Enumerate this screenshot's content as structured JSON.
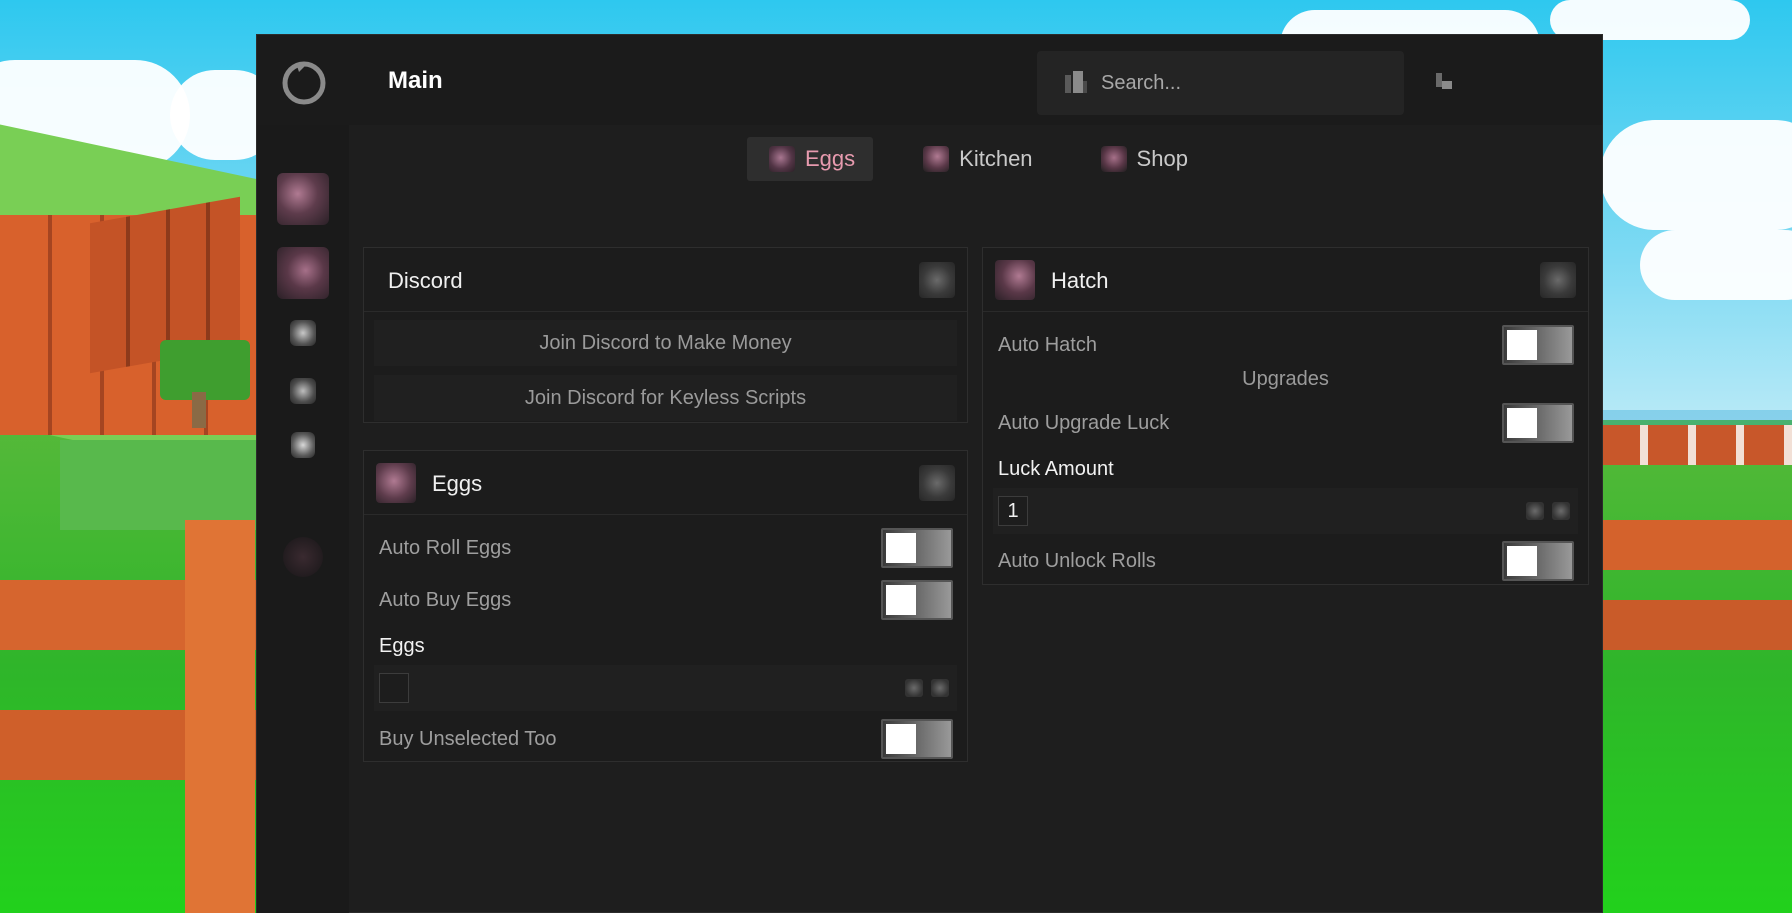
{
  "window": {
    "title": "Main",
    "search": {
      "placeholder": "Search..."
    }
  },
  "tabs": [
    {
      "label": "Eggs",
      "active": true
    },
    {
      "label": "Kitchen",
      "active": false
    },
    {
      "label": "Shop",
      "active": false
    }
  ],
  "discord_panel": {
    "title": "Discord",
    "buttons": [
      "Join Discord to Make Money",
      "Join Discord for Keyless Scripts"
    ]
  },
  "eggs_panel": {
    "title": "Eggs",
    "toggles": [
      {
        "label": "Auto Roll Eggs",
        "on": false
      },
      {
        "label": "Auto Buy Eggs",
        "on": false
      }
    ],
    "dropdown_label": "Eggs",
    "dropdown_value": "",
    "toggle_last": {
      "label": "Buy Unselected Too",
      "on": false
    }
  },
  "hatch_panel": {
    "title": "Hatch",
    "auto_hatch": {
      "label": "Auto Hatch",
      "on": false
    },
    "section": "Upgrades",
    "auto_upgrade_luck": {
      "label": "Auto Upgrade Luck",
      "on": false
    },
    "luck_amount": {
      "label": "Luck Amount",
      "value": "1"
    },
    "auto_unlock_rolls": {
      "label": "Auto Unlock Rolls",
      "on": false
    }
  },
  "colors": {
    "accent": "#e79aae",
    "window_bg": "#1e1e1e",
    "panel_bg": "#1c1c1c"
  },
  "icons": {
    "logo": "refresh-ring-icon",
    "search": "search-icon",
    "minimize": "minimize-icon",
    "collapse": "collapse-icon"
  }
}
